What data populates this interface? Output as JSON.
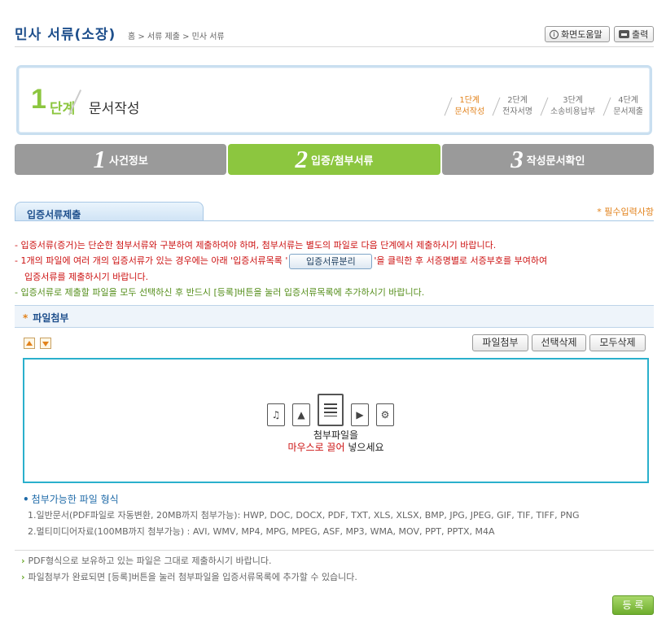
{
  "header": {
    "title": "민사 서류(소장)",
    "breadcrumb": "홈 > 서류 제출 > 민사 서류",
    "help_label": "화면도움말",
    "print_label": "출력"
  },
  "step_box": {
    "number": "1",
    "word": "단계",
    "title": "문서작성",
    "mini_steps": [
      {
        "step": "1단계",
        "label": "문서작성"
      },
      {
        "step": "2단계",
        "label": "전자서명"
      },
      {
        "step": "3단계",
        "label": "소송비용납부"
      },
      {
        "step": "4단계",
        "label": "문서제출"
      }
    ]
  },
  "tabs": [
    {
      "num": "1",
      "label": "사건정보"
    },
    {
      "num": "2",
      "label": "입증/첨부서류"
    },
    {
      "num": "3",
      "label": "작성문서확인"
    }
  ],
  "section": {
    "title": "입증서류제출",
    "required_note": "* 필수입력사항"
  },
  "notes": {
    "line1": "- 입증서류(증거)는 단순한 첨부서류와 구분하여 제출하여야 하며, 첨부서류는 별도의 파일로 다음 단계에서 제출하시기 바랍니다.",
    "line2_before": "- 1개의 파일에 여러 개의 입증서류가 있는 경우에는 아래 '입증서류목록 '",
    "line2_button": "입증서류분리",
    "line2_after": "'을 클릭한 후 서증명별로 서증부호를 부여하여",
    "line3": "입증서류를 제출하시기 바랍니다.",
    "line4": "- 입증서류로 제출할 파일을 모두 선택하신 후 반드시 [등록]버튼을 눌러 입증서류목록에 추가하시기 바랍니다."
  },
  "attach": {
    "star": "*",
    "title": "파일첨부",
    "buttons": {
      "attach": "파일첨부",
      "delete_selected": "선택삭제",
      "delete_all": "모두삭제"
    },
    "drop_line1": "첨부파일을",
    "drop_red": "마우스로 끌어",
    "drop_rest": "넣으세요",
    "formats_title": "첨부가능한 파일 형식",
    "formats_1": "1.일반문서(PDF파일로 자동변환, 20MB까지 첨부가능): HWP, DOC, DOCX, PDF, TXT, XLS, XLSX, BMP, JPG, JPEG, GIF, TIF, TIFF, PNG",
    "formats_2": "2.멀티미디어자료(100MB까지 첨부가능) : AVI, WMV, MP4, MPG, MPEG, ASF, MP3, WMA, MOV, PPT, PPTX, M4A"
  },
  "tips": {
    "tip1": "PDF형식으로 보유하고 있는 파일은 그대로 제출하시기 바랍니다.",
    "tip2": "파일첨부가 완료되면 [등록]버튼을 눌러 첨부파일을 입증서류목록에 추가할 수 있습니다."
  },
  "register_label": "등 록"
}
